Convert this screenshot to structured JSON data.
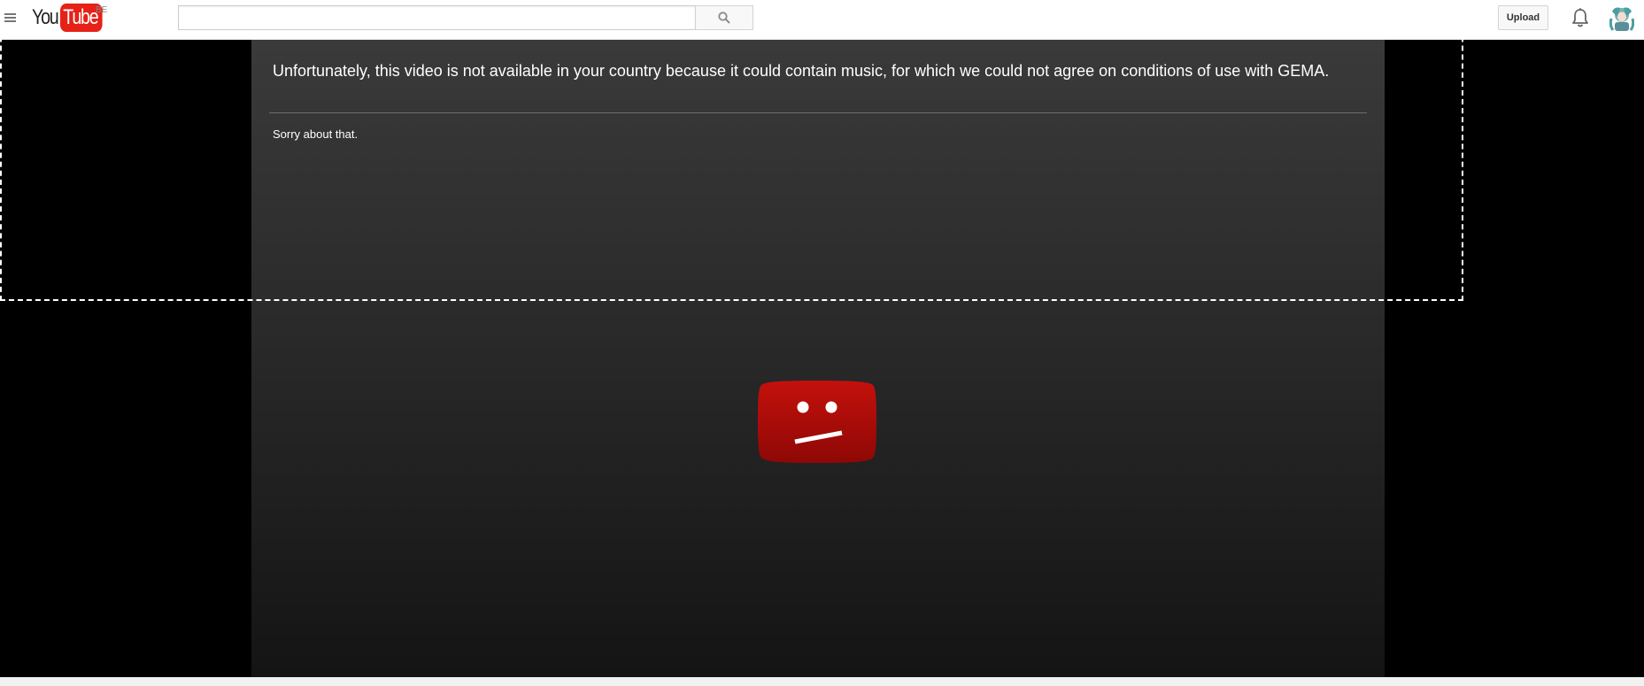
{
  "masthead": {
    "logo_you": "You",
    "logo_tube": "Tube",
    "country_code": "BE",
    "search": {
      "value": "",
      "placeholder": ""
    },
    "upload_label": "Upload",
    "icons": {
      "guide": "hamburger-menu-icon",
      "search": "search-icon",
      "notifications": "bell-icon",
      "avatar": "user-avatar"
    }
  },
  "player": {
    "error_message": "Unfortunately, this video is not available in your country because it could contain music, for which we could not agree on conditions of use with GEMA.",
    "error_subtitle": "Sorry about that.",
    "icon": "sad-face-icon"
  },
  "colors": {
    "brand_red": "#e62117",
    "sad_face_red": "#b80f0a",
    "player_bg_top": "#3a3a3a",
    "player_bg_bottom": "#141414"
  }
}
